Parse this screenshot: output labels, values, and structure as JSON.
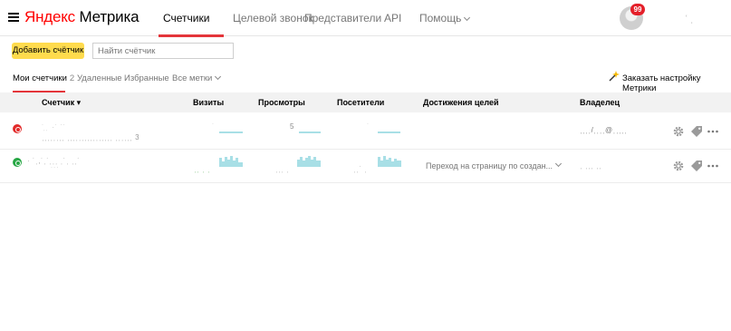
{
  "header": {
    "logo_brand": "Яндекс",
    "logo_product": "Метрика",
    "tabs": [
      {
        "label": "Счетчики",
        "active": true
      },
      {
        "label": "Целевой звонок"
      },
      {
        "label": "Представители"
      },
      {
        "label": "API"
      },
      {
        "label": "Помощь"
      }
    ],
    "notifications_count": "99",
    "user": "ʿ ˌ"
  },
  "toolbar": {
    "add_counter_label": "Добавить счётчик",
    "search_placeholder": "Найти счётчик"
  },
  "subtabs": {
    "my_counters": "Мои счетчики",
    "my_counters_count": "2",
    "deleted": "Удаленные",
    "favorites": "Избранные",
    "all_tags": "Все метки"
  },
  "order_setup": "Заказать настройку Метрики",
  "table": {
    "columns": {
      "counter": "Счетчик ▾",
      "visits": "Визиты",
      "views": "Просмотры",
      "visitors": "Посетители",
      "goals": "Достижения целей",
      "owner": "Владелец"
    },
    "rows": [
      {
        "status": "red",
        "name": "˙ ̣ ̣ ·˙ ˙˙",
        "url": "ˌˌˌˌˌˌˌˌ ˌˌˌˌˌˌˌˌˌˌˌˌˌˌˌˌ ˌˌˌˌˌˌ 3",
        "visits": "˙",
        "views": "5",
        "visitors": "˙",
        "goal": "",
        "owner": "ˌˌˌˌ/ˌˌˌˌ@ˌˌˌˌˌ"
      },
      {
        "status": "green",
        "name": "· ˙ˌ,˙ˌ˙ˌˌˌ ˌ˙ˌ ˌˌ˙",
        "url": "˙˙˙",
        "visits": "ˌˌ ˌ ˌ",
        "views": "ˌˌˌ ˌ",
        "visitors": "ˌˌ˙ ˌ",
        "goal": "Переход на страницу по создан...",
        "owner": "ˌ ˌˌˌ ˌˌ"
      }
    ]
  },
  "colors": {
    "accent": "#e4353a",
    "add_button": "#ffdb4d",
    "status_red": "#e22a2a",
    "status_green": "#28a745",
    "spark": "#a8dfe6"
  },
  "icons": [
    "menu-icon",
    "chevron-down-icon",
    "magic-wand-icon",
    "status-icon",
    "gear-icon",
    "tag-icon",
    "more-icon"
  ]
}
